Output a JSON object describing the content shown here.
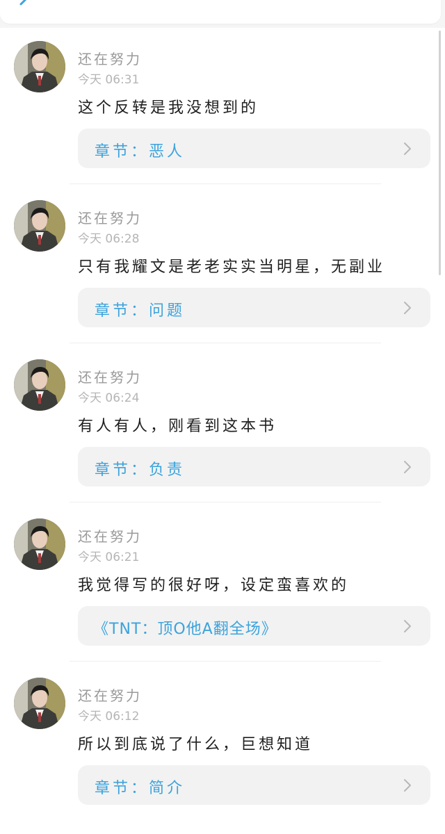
{
  "colors": {
    "link": "#3ca3dc",
    "username": "#9a9a9a",
    "time": "#b5b5b5",
    "text": "#1f1f1f",
    "card": "#f2f2f2"
  },
  "header": {
    "back_icon": "back-chevron-icon"
  },
  "comments": [
    {
      "username": "还在努力",
      "time": "今天 06:31",
      "text": "这个反转是我没想到的",
      "link": "章节：恶人"
    },
    {
      "username": "还在努力",
      "time": "今天 06:28",
      "text": "只有我耀文是老老实实当明星，无副业",
      "link": "章节：问题"
    },
    {
      "username": "还在努力",
      "time": "今天 06:24",
      "text": "有人有人，刚看到这本书",
      "link": "章节：负责"
    },
    {
      "username": "还在努力",
      "time": "今天 06:21",
      "text": "我觉得写的很好呀，设定蛮喜欢的",
      "link": "《TNT：顶O他A翻全场》"
    },
    {
      "username": "还在努力",
      "time": "今天 06:12",
      "text": "所以到底说了什么，巨想知道",
      "link": "章节：简介"
    }
  ]
}
